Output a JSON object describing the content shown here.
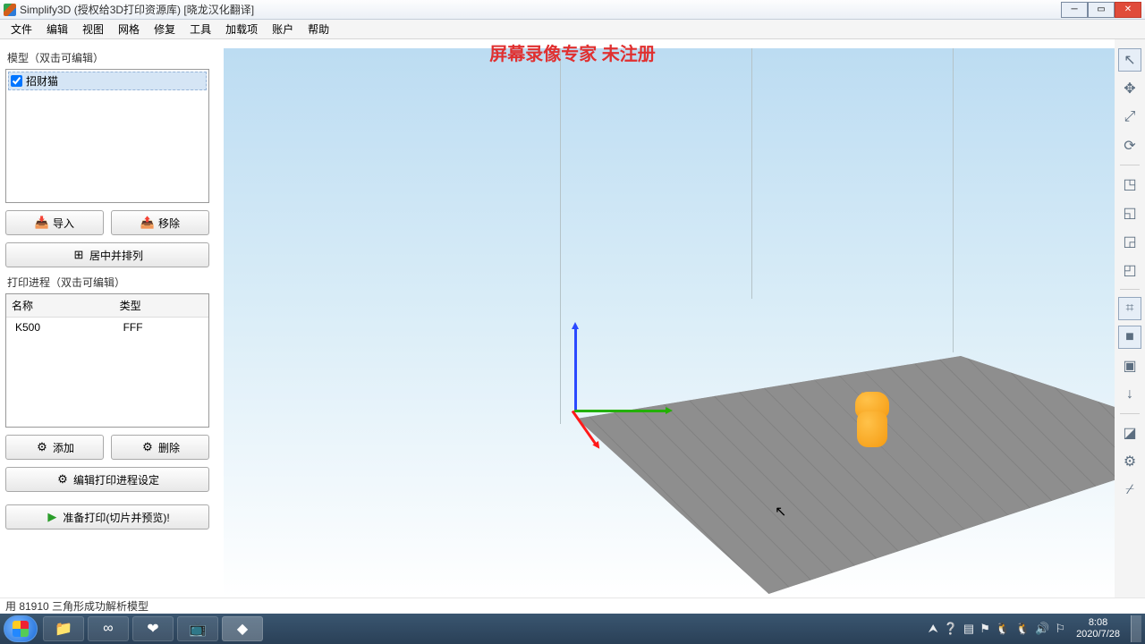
{
  "window": {
    "app_name": "Simplify3D",
    "title_suffix": "(授权给3D打印资源库)  [晓龙汉化翻译]",
    "watermark": "屏幕录像专家  未注册"
  },
  "menu": [
    "文件",
    "编辑",
    "视图",
    "网格",
    "修复",
    "工具",
    "加载项",
    "账户",
    "帮助"
  ],
  "models_panel": {
    "title": "模型（双击可编辑）",
    "items": [
      {
        "checked": true,
        "name": "招财猫"
      }
    ],
    "import_label": "导入",
    "remove_label": "移除",
    "center_arrange_label": "居中并排列"
  },
  "process_panel": {
    "title": "打印进程（双击可编辑）",
    "columns": [
      "名称",
      "类型"
    ],
    "rows": [
      {
        "name": "K500",
        "type": "FFF"
      }
    ],
    "add_label": "添加",
    "delete_label": "删除",
    "edit_label": "编辑打印进程设定",
    "prepare_label": "准备打印(切片并预览)!"
  },
  "right_tools": [
    {
      "name": "select-tool",
      "glyph": "↖",
      "active": true
    },
    {
      "name": "move-tool",
      "glyph": "✥",
      "active": false
    },
    {
      "name": "scale-tool",
      "glyph": "⤢",
      "active": false
    },
    {
      "name": "rotate-tool",
      "glyph": "⟳",
      "active": false
    },
    {
      "sep": true
    },
    {
      "name": "view-front",
      "glyph": "◳",
      "active": false
    },
    {
      "name": "view-left",
      "glyph": "◱",
      "active": false
    },
    {
      "name": "view-right",
      "glyph": "◲",
      "active": false
    },
    {
      "name": "view-top",
      "glyph": "◰",
      "active": false
    },
    {
      "sep": true
    },
    {
      "name": "axes-tool",
      "glyph": "⌗",
      "active": true
    },
    {
      "name": "solid-tool",
      "glyph": "■",
      "active": true
    },
    {
      "name": "wire-tool",
      "glyph": "▣",
      "active": false
    },
    {
      "name": "normals-tool",
      "glyph": "↓",
      "active": false
    },
    {
      "sep": true
    },
    {
      "name": "cross-section-tool",
      "glyph": "◪",
      "active": false
    },
    {
      "name": "settings-tool",
      "glyph": "⚙",
      "active": false
    },
    {
      "name": "supports-tool",
      "glyph": "⌿",
      "active": false
    }
  ],
  "status": "用 81910 三角形成功解析模型",
  "taskbar": {
    "apps": [
      {
        "name": "explorer",
        "glyph": "📁",
        "active": false
      },
      {
        "name": "baidu-netdisk",
        "glyph": "∞",
        "active": false
      },
      {
        "name": "app-heart",
        "glyph": "❤",
        "active": false
      },
      {
        "name": "app-tv",
        "glyph": "📺",
        "active": false
      },
      {
        "name": "simplify3d",
        "glyph": "◆",
        "active": true
      }
    ],
    "tray": [
      "⮝",
      "❔",
      "▤",
      "⚑",
      "🐧",
      "🐧",
      "🔊",
      "⚐"
    ],
    "time": "8:08",
    "date": "2020/7/28"
  }
}
